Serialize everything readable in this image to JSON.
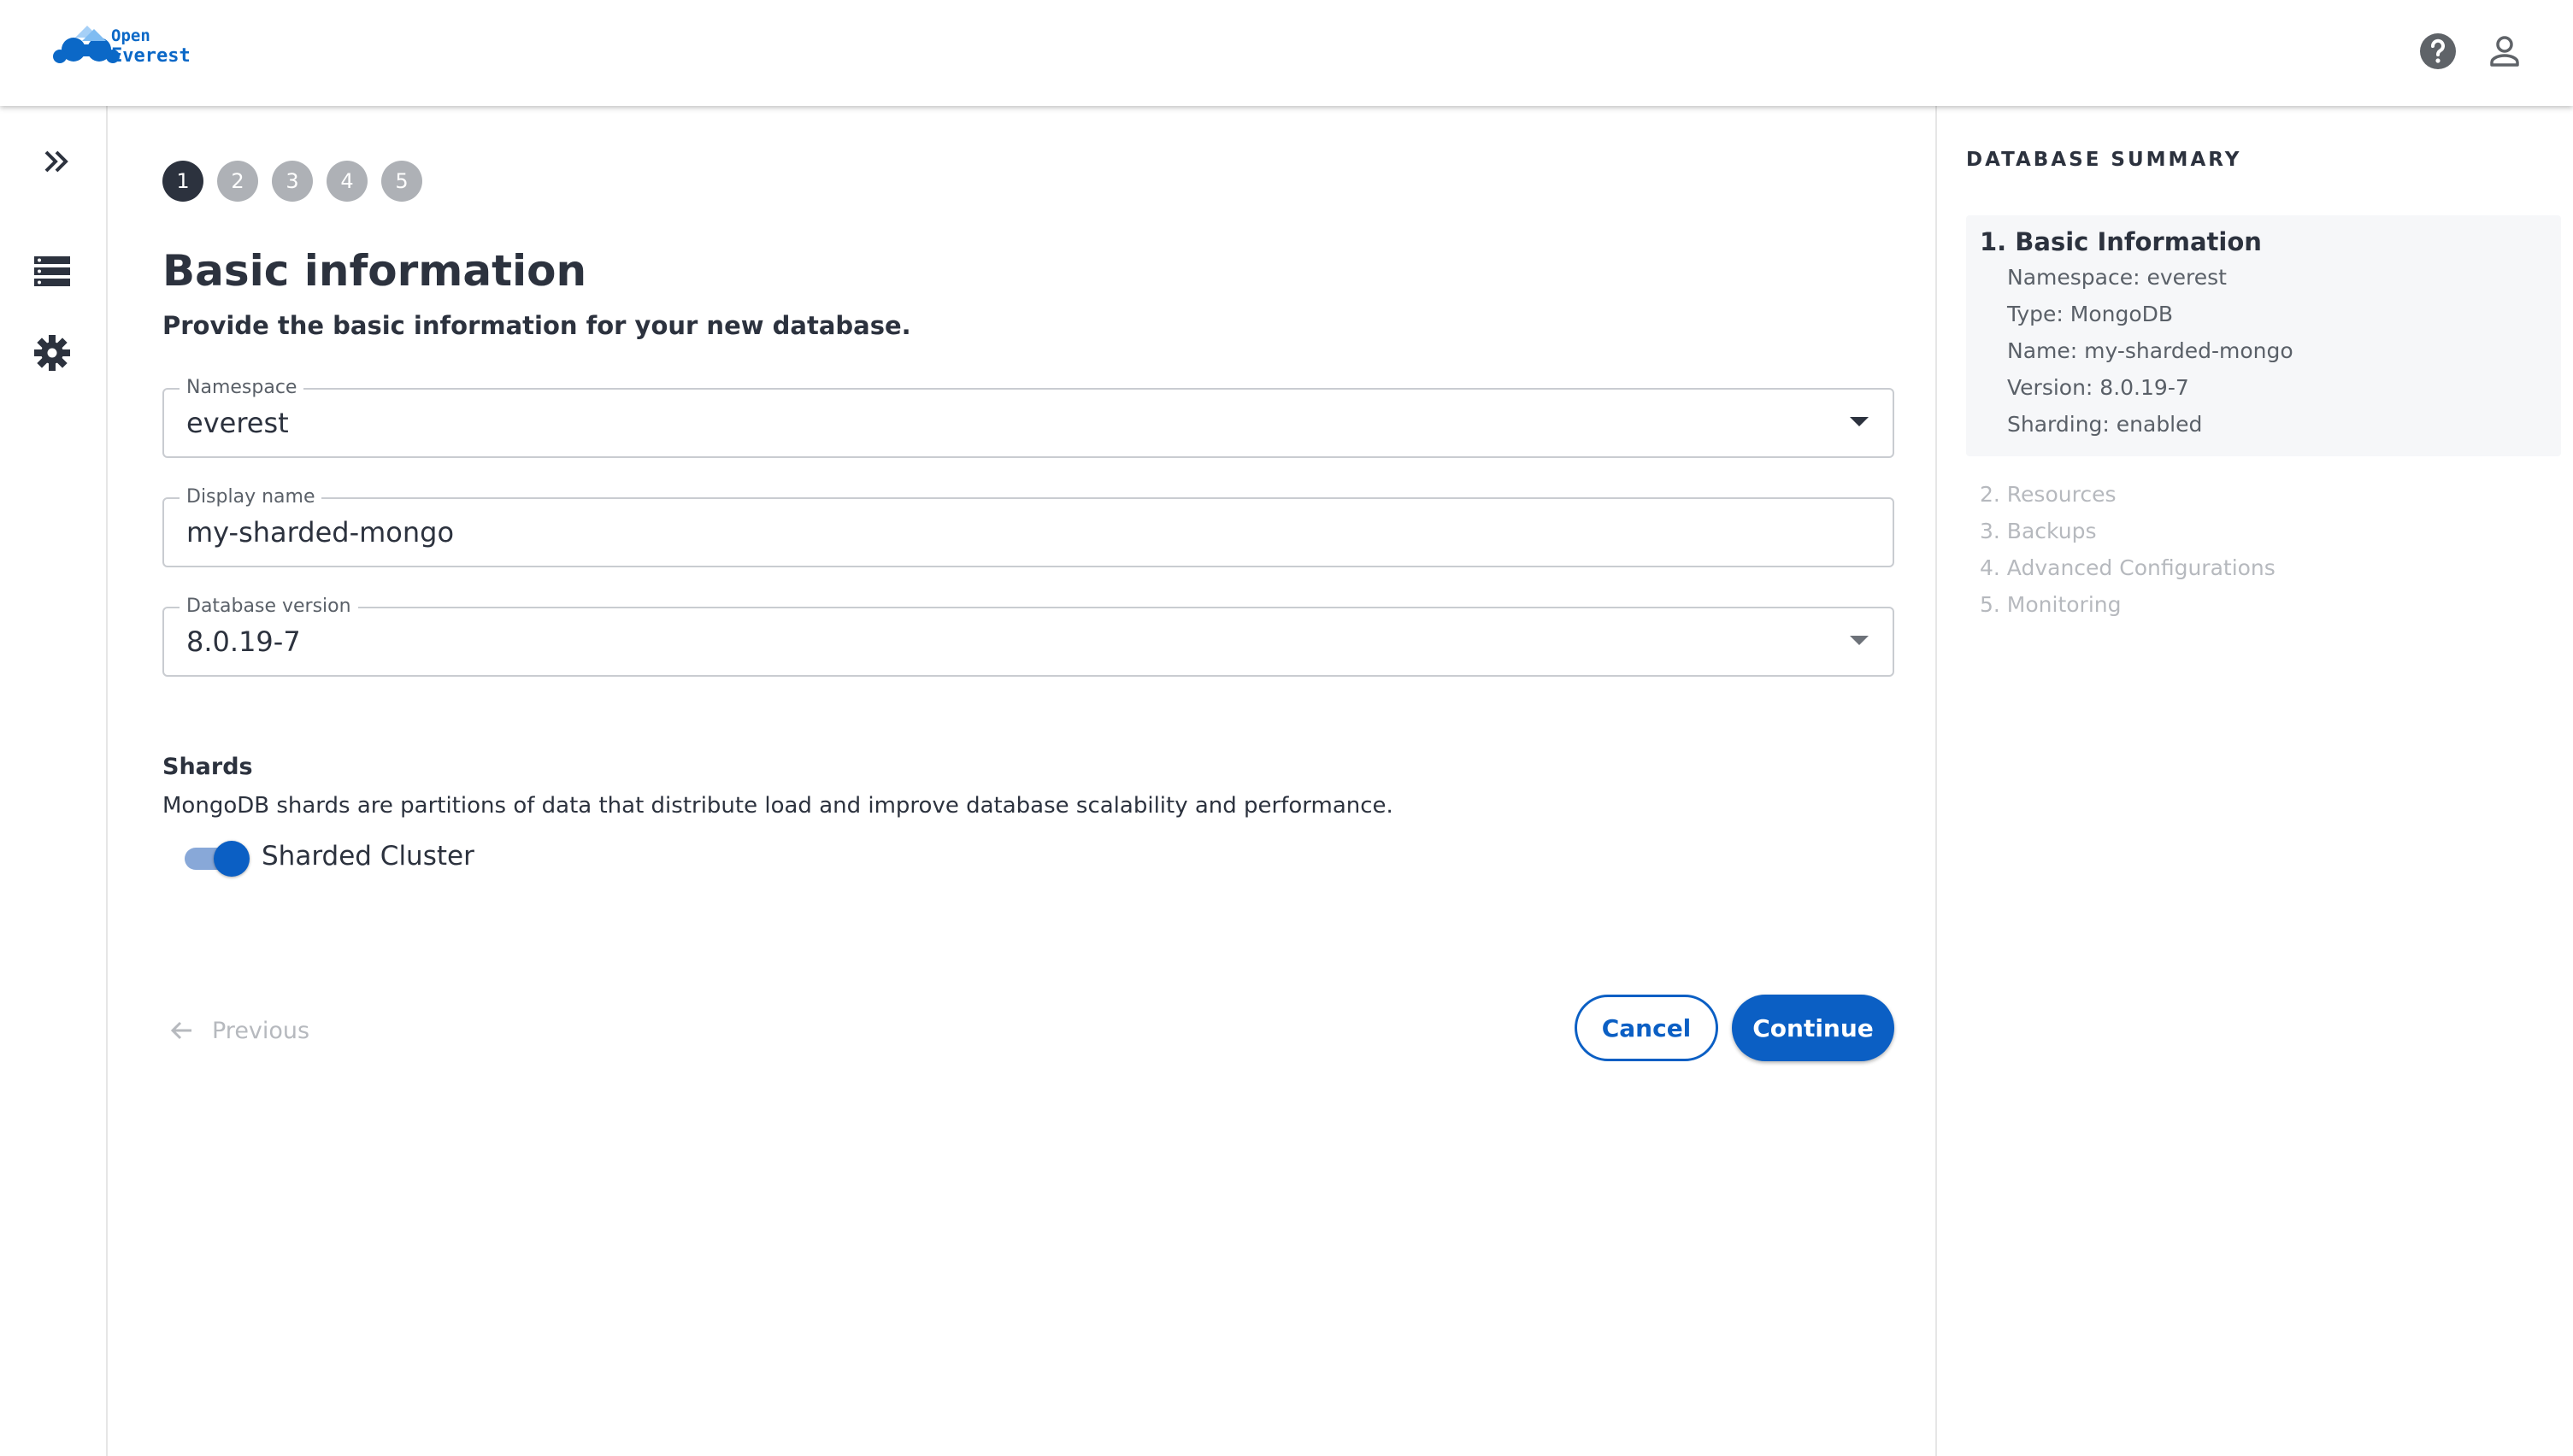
{
  "header": {
    "logo": {
      "line1": "Open",
      "line2": "Everest"
    },
    "icons": [
      "help-icon",
      "user-icon"
    ]
  },
  "rail": {
    "icons": [
      "expand-chevrons-icon",
      "databases-list-icon",
      "settings-gear-icon"
    ]
  },
  "stepper": {
    "steps": [
      "1",
      "2",
      "3",
      "4",
      "5"
    ],
    "active": 0
  },
  "main": {
    "title": "Basic information",
    "subtitle": "Provide the basic information for your new database.",
    "namespace": {
      "label": "Namespace",
      "value": "everest"
    },
    "display_name": {
      "label": "Display name",
      "value": "my-sharded-mongo"
    },
    "db_version": {
      "label": "Database version",
      "value": "8.0.19-7"
    },
    "shards": {
      "title": "Shards",
      "description": "MongoDB shards are partitions of data that distribute load and improve database scalability and performance.",
      "toggle_label": "Sharded Cluster",
      "enabled": true
    },
    "actions": {
      "previous": "Previous",
      "cancel": "Cancel",
      "continue": "Continue"
    }
  },
  "summary": {
    "title": "DATABASE SUMMARY",
    "section1": {
      "title": "1. Basic Information",
      "lines": [
        "Namespace: everest",
        "Type: MongoDB",
        "Name: my-sharded-mongo",
        "Version: 8.0.19-7",
        "Sharding: enabled"
      ]
    },
    "steps": [
      "2. Resources",
      "3. Backups",
      "4. Advanced Configurations",
      "5. Monitoring"
    ]
  },
  "colors": {
    "primary": "#0b5fc4",
    "dark": "#2c323e",
    "muted": "#b6b9be"
  }
}
